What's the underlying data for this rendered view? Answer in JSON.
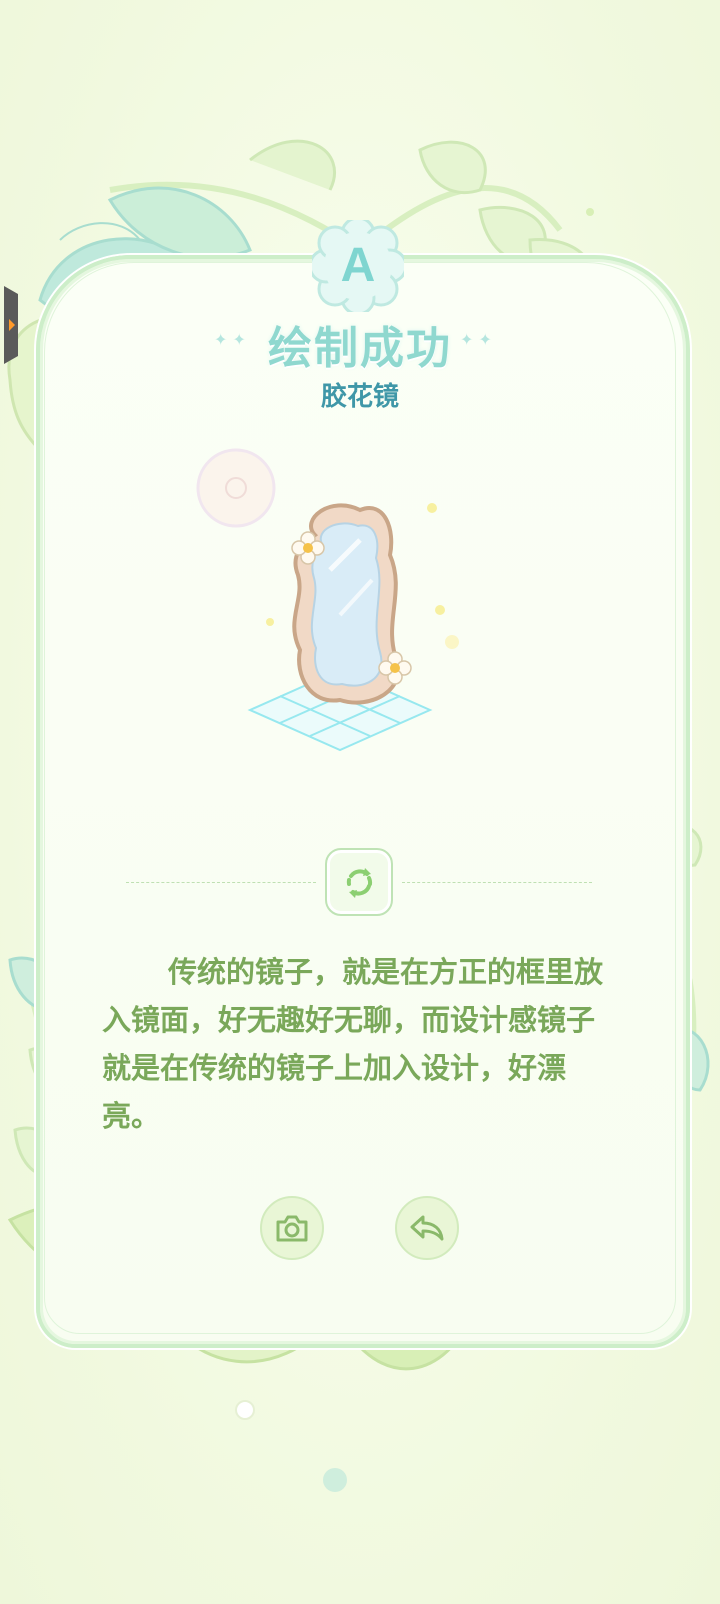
{
  "result": {
    "grade": "A",
    "title": "绘制成功",
    "item_name": "胶花镜",
    "description": "传统的镜子，就是在方正的框里放入镜面，好无趣好无聊，而设计感镜子就是在传统的镜子上加入设计，好漂亮。"
  },
  "icons": {
    "refresh": "refresh-icon",
    "camera": "camera-icon",
    "back": "back-icon",
    "side_tab": "chevron-right-icon"
  },
  "colors": {
    "background": "#f3fae3",
    "title": "#8fd8cf",
    "subtitle": "#3f97a8",
    "description": "#7aa85a",
    "card_border": "#cdeec9",
    "leaf_light": "#d9efb8",
    "leaf_teal": "#bfe9dc"
  }
}
